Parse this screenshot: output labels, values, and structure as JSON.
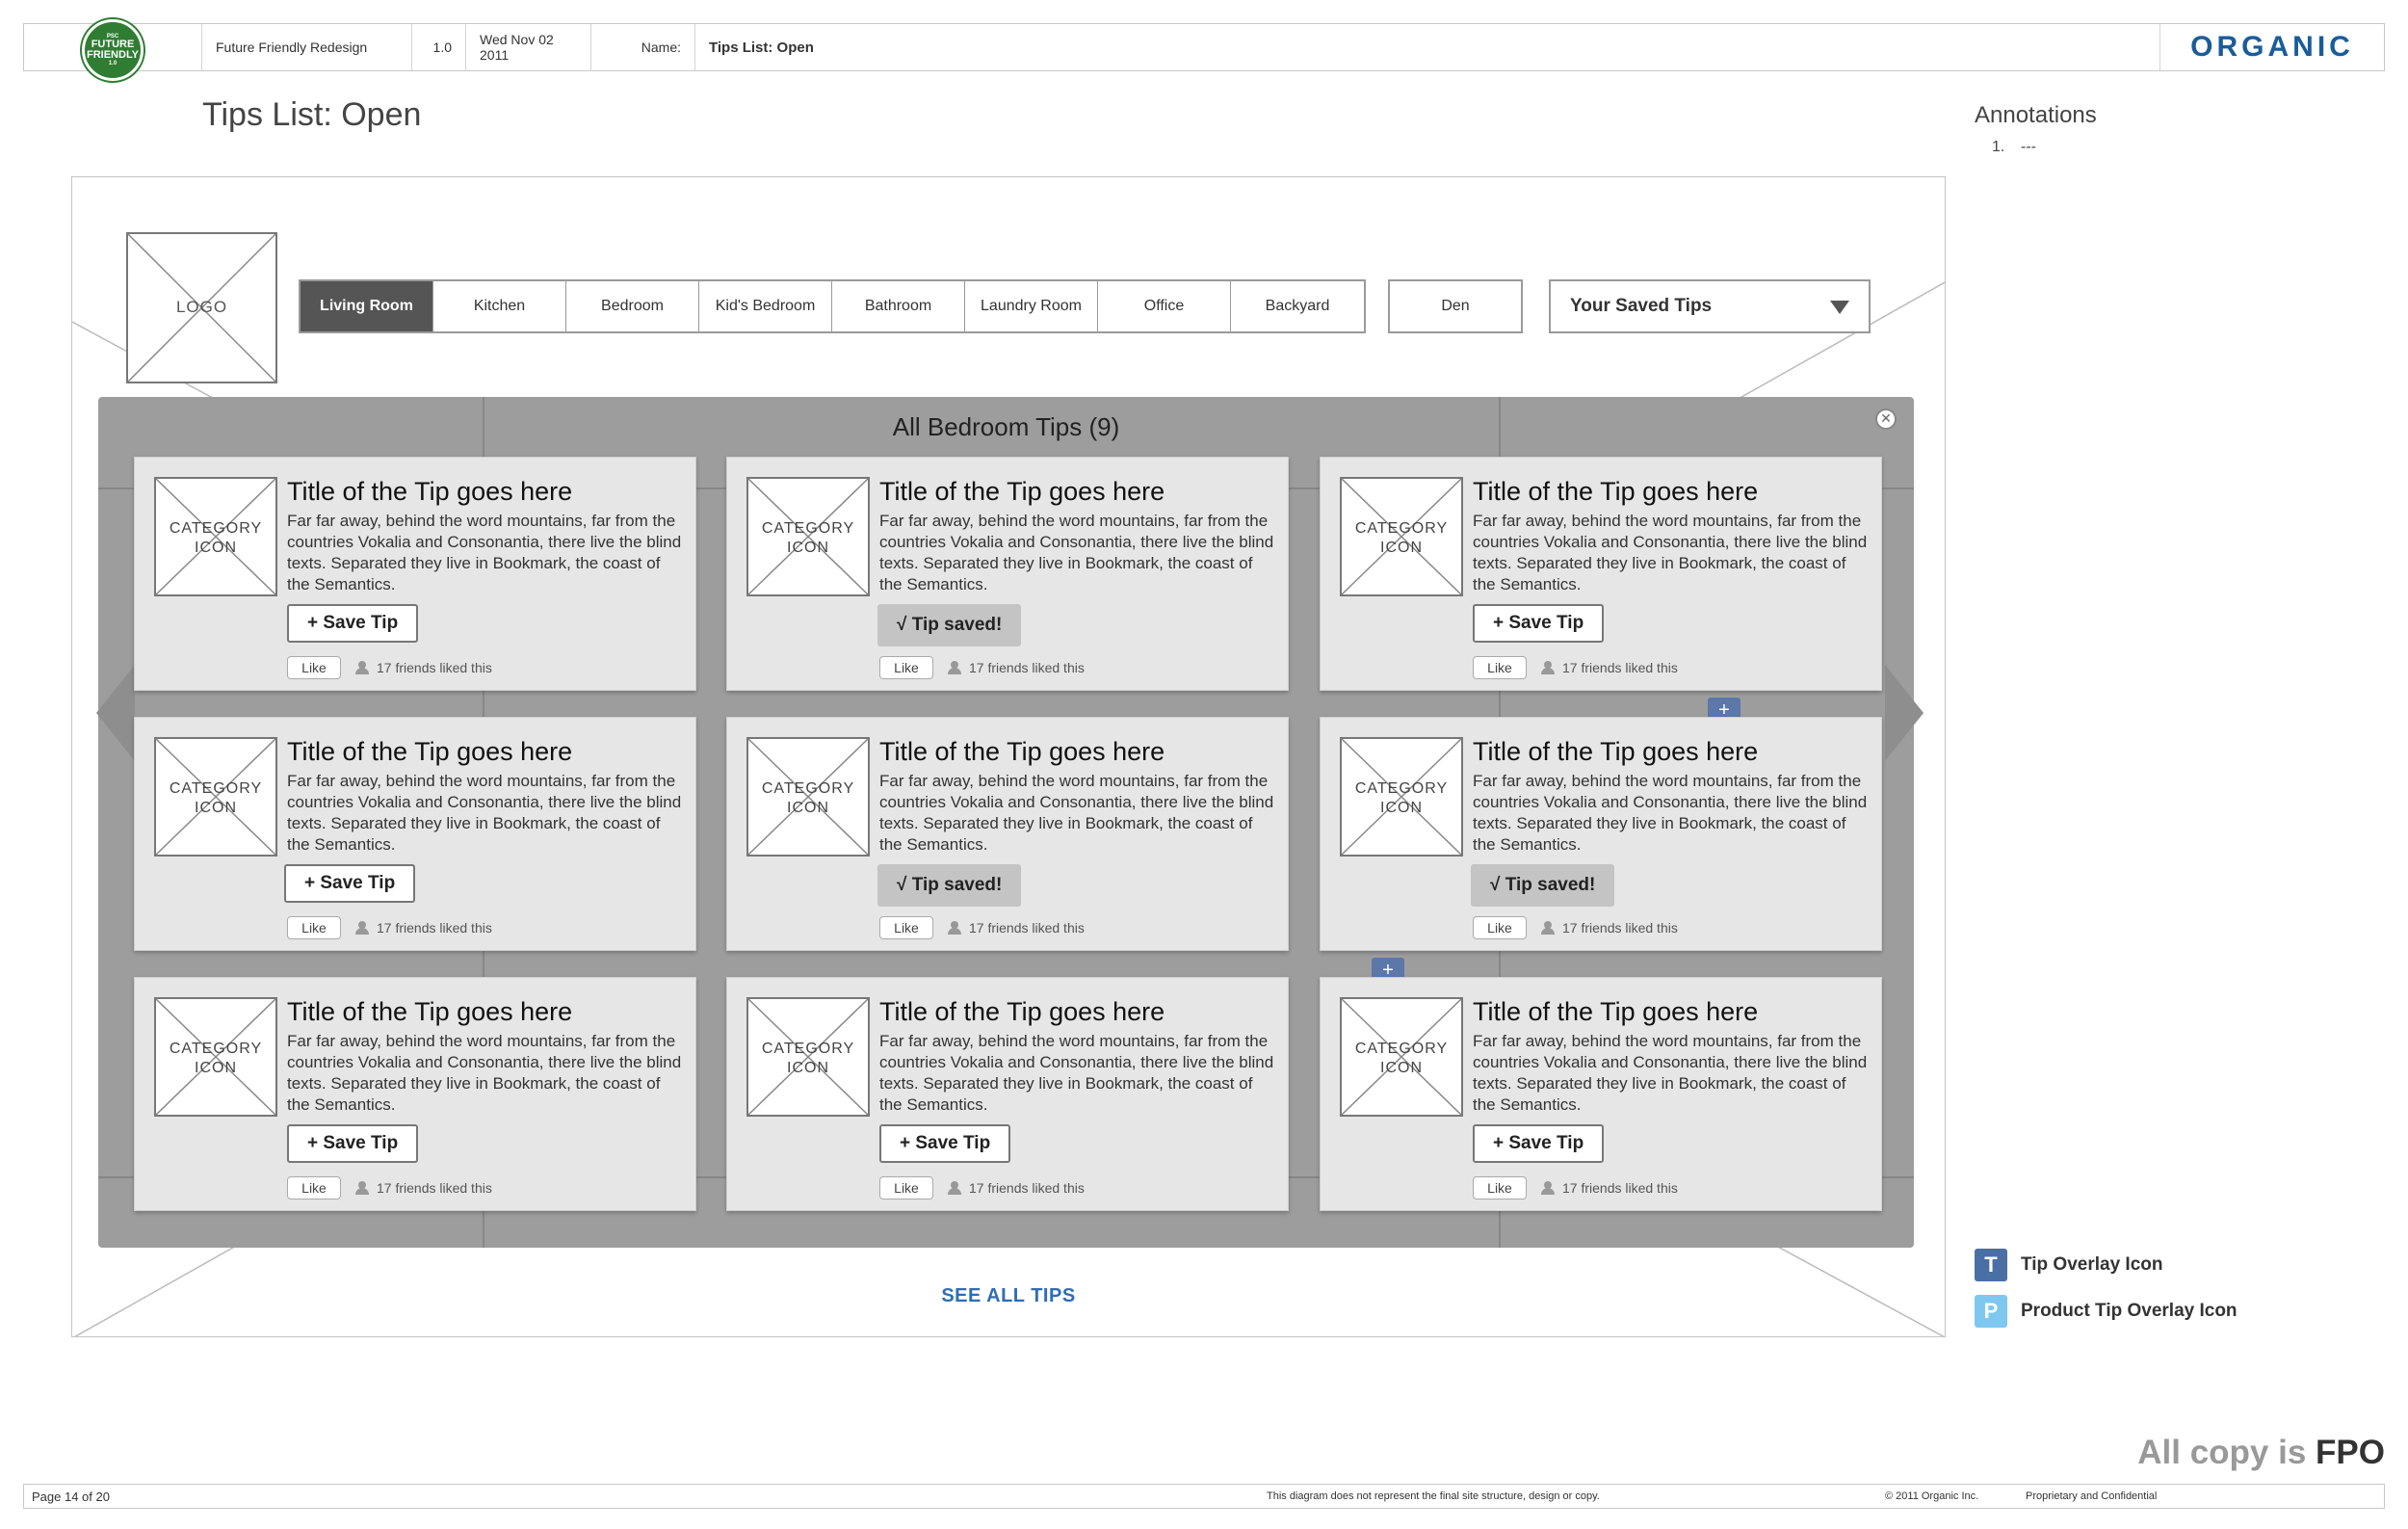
{
  "header": {
    "badge": {
      "small": "PSC",
      "line1": "FUTURE",
      "line2": "FRIENDLY",
      "small2": "1.0"
    },
    "project": "Future Friendly Redesign",
    "version": "1.0",
    "date": "Wed Nov 02 2011",
    "name_label": "Name:",
    "name_value": "Tips List: Open",
    "brand": "ORGANIC"
  },
  "page_title": "Tips List: Open",
  "annotations": {
    "title": "Annotations",
    "items": [
      {
        "num": "1.",
        "text": "---"
      }
    ]
  },
  "site": {
    "logo": "LOGO",
    "nav": [
      "Living Room",
      "Kitchen",
      "Bedroom",
      "Kid's Bedroom",
      "Bathroom",
      "Laundry Room",
      "Office",
      "Backyard"
    ],
    "den": "Den",
    "saved_dropdown": "Your Saved Tips"
  },
  "overlay": {
    "title": "All Bedroom Tips (9)",
    "close": "✕",
    "plus": "+",
    "cards": [
      {
        "icon": "CATEGORY\nICON",
        "title": "Title of the Tip goes here",
        "body": "Far far away, behind the word mountains, far from the countries Vokalia and Consonantia, there live the blind texts. Separated they live in Bookmark, the coast of the Semantics.",
        "action": "+ Save Tip",
        "saved": false,
        "like": "Like",
        "friends": "17 friends liked this"
      },
      {
        "icon": "CATEGORY\nICON",
        "title": "Title of the Tip goes here",
        "body": "Far far away, behind the word mountains, far from the countries Vokalia and Consonantia, there live the blind texts. Separated they live in Bookmark, the coast of the Semantics.",
        "action": "√  Tip saved!",
        "saved": true,
        "like": "Like",
        "friends": "17 friends liked this"
      },
      {
        "icon": "CATEGORY\nICON",
        "title": "Title of the Tip goes here",
        "body": "Far far away, behind the word mountains, far from the countries Vokalia and Consonantia, there live the blind texts. Separated they live in Bookmark, the coast of the Semantics.",
        "action": "+ Save Tip",
        "saved": false,
        "like": "Like",
        "friends": "17 friends liked this"
      },
      {
        "icon": "CATEGORY\nICON",
        "title": "Title of the Tip goes here",
        "body": "Far far away, behind the word mountains, far from the countries Vokalia and Consonantia, there live the blind texts. Separated they live in Bookmark, the coast of the Semantics.",
        "action": "+ Save Tip",
        "saved": false,
        "like": "Like",
        "friends": "17 friends liked this"
      },
      {
        "icon": "CATEGORY\nICON",
        "title": "Title of the Tip goes here",
        "body": "Far far away, behind the word mountains, far from the countries Vokalia and Consonantia, there live the blind texts. Separated they live in Bookmark, the coast of the Semantics.",
        "action": "√  Tip saved!",
        "saved": true,
        "like": "Like",
        "friends": "17 friends liked this"
      },
      {
        "icon": "CATEGORY\nICON",
        "title": "Title of the Tip goes here",
        "body": "Far far away, behind the word mountains, far from the countries Vokalia and Consonantia, there live the blind texts. Separated they live in Bookmark, the coast of the Semantics.",
        "action": "√  Tip saved!",
        "saved": true,
        "like": "Like",
        "friends": "17 friends liked this"
      },
      {
        "icon": "CATEGORY\nICON",
        "title": "Title of the Tip goes here",
        "body": "Far far away, behind the word mountains, far from the countries Vokalia and Consonantia, there live the blind texts. Separated they live in Bookmark, the coast of the Semantics.",
        "action": "+ Save Tip",
        "saved": false,
        "like": "Like",
        "friends": "17 friends liked this"
      },
      {
        "icon": "CATEGORY\nICON",
        "title": "Title of the Tip goes here",
        "body": "Far far away, behind the word mountains, far from the countries Vokalia and Consonantia, there live the blind texts. Separated they live in Bookmark, the coast of the Semantics.",
        "action": "+ Save Tip",
        "saved": false,
        "like": "Like",
        "friends": "17 friends liked this"
      },
      {
        "icon": "CATEGORY\nICON",
        "title": "Title of the Tip goes here",
        "body": "Far far away, behind the word mountains, far from the countries Vokalia and Consonantia, there live the blind texts. Separated they live in Bookmark, the coast of the Semantics.",
        "action": "+ Save Tip",
        "saved": false,
        "like": "Like",
        "friends": "17 friends liked this"
      }
    ]
  },
  "see_all": "SEE ALL TIPS",
  "legend": [
    {
      "key": "T",
      "label": "Tip Overlay Icon",
      "color": "#4a6fa5"
    },
    {
      "key": "P",
      "label": "Product Tip Overlay Icon",
      "color": "#7ec8f0"
    }
  ],
  "fpo": {
    "prefix": "All copy is",
    "strong": "FPO"
  },
  "footer": {
    "page": "Page 14 of 20",
    "disclaimer": "This diagram does not represent the final site structure, design or copy.",
    "copyright": "© 2011 Organic Inc.",
    "proprietary": "Proprietary and Confidential"
  },
  "colors": {
    "brand": "#1a5c9a",
    "link": "#2e6db4",
    "overlay": "#9d9d9d",
    "active_tab": "#555555",
    "plus_chip": "#5b78a8"
  }
}
